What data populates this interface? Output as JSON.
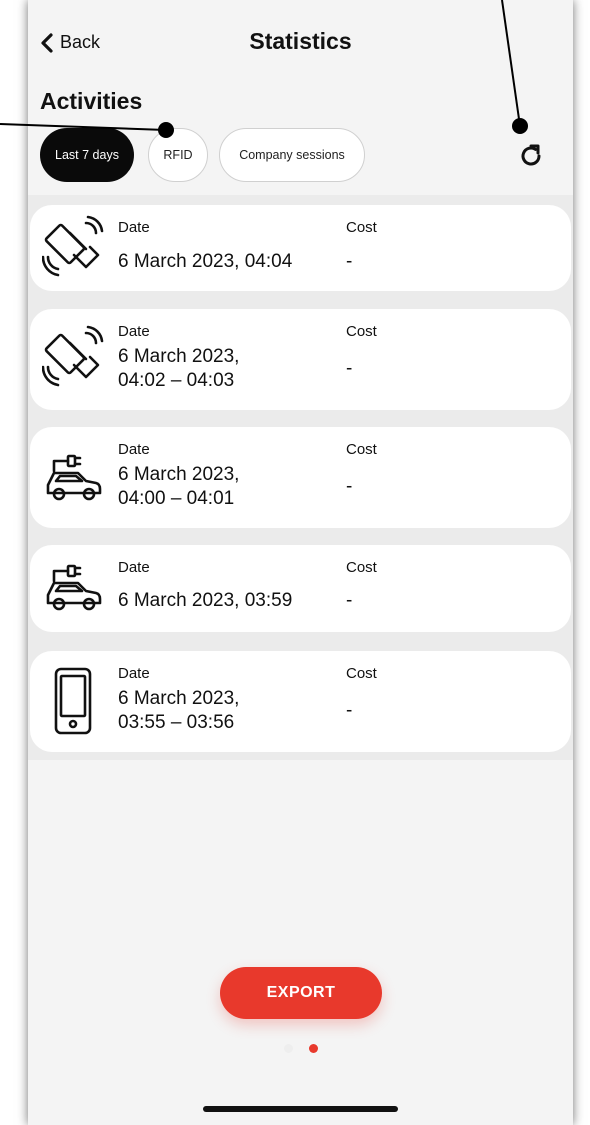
{
  "nav": {
    "back_label": "Back",
    "title": "Statistics"
  },
  "section_title": "Activities",
  "filters": [
    {
      "label": "Last 7 days",
      "active": true
    },
    {
      "label": "RFID",
      "active": false
    },
    {
      "label": "Company sessions",
      "active": false
    }
  ],
  "refresh_icon": "refresh-icon",
  "activities": [
    {
      "icon": "rfid-card-icon",
      "date_label": "Date",
      "date_line1": "6 March 2023, 04:04",
      "date_line2": "",
      "cost_label": "Cost",
      "cost": "-"
    },
    {
      "icon": "rfid-card-icon",
      "date_label": "Date",
      "date_line1": "6 March 2023,",
      "date_line2": "04:02 – 04:03",
      "cost_label": "Cost",
      "cost": "-"
    },
    {
      "icon": "ev-charging-car-icon",
      "date_label": "Date",
      "date_line1": "6 March 2023,",
      "date_line2": "04:00 – 04:01",
      "cost_label": "Cost",
      "cost": "-"
    },
    {
      "icon": "ev-charging-car-icon",
      "date_label": "Date",
      "date_line1": "6 March 2023, 03:59",
      "date_line2": "",
      "cost_label": "Cost",
      "cost": "-"
    },
    {
      "icon": "mobile-phone-icon",
      "date_label": "Date",
      "date_line1": "6 March 2023,",
      "date_line2": "03:55 – 03:56",
      "cost_label": "Cost",
      "cost": "-"
    }
  ],
  "export_label": "EXPORT",
  "pagination": {
    "total": 2,
    "current": 2
  },
  "colors": {
    "accent": "#e8392c",
    "active_chip": "#0a0a0a",
    "background": "#f4f4f4",
    "card": "#ffffff"
  }
}
